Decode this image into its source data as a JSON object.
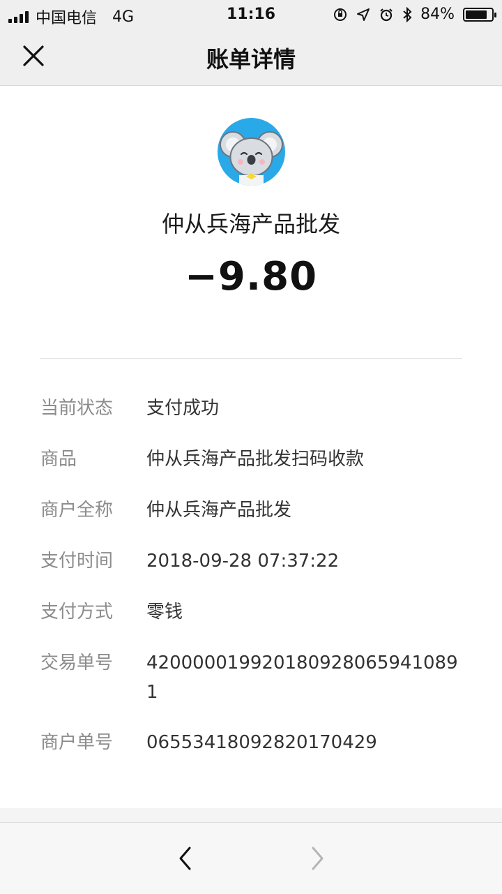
{
  "status_bar": {
    "carrier": "中国电信",
    "network": "4G",
    "time": "11:16",
    "battery": "84%",
    "battery_level": 0.84
  },
  "nav": {
    "title": "账单详情"
  },
  "merchant": {
    "name": "仲从兵海产品批发",
    "amount": "−9.80",
    "avatar_color": "#29a9e8"
  },
  "details": [
    {
      "label": "当前状态",
      "value": "支付成功"
    },
    {
      "label": "商品",
      "value": "仲从兵海产品批发扫码收款"
    },
    {
      "label": "商户全称",
      "value": "仲从兵海产品批发"
    },
    {
      "label": "支付时间",
      "value": "2018-09-28 07:37:22"
    },
    {
      "label": "支付方式",
      "value": "零钱"
    },
    {
      "label": "交易单号",
      "value": "4200000199201809280659410891"
    },
    {
      "label": "商户单号",
      "value": "06553418092820170429"
    }
  ]
}
